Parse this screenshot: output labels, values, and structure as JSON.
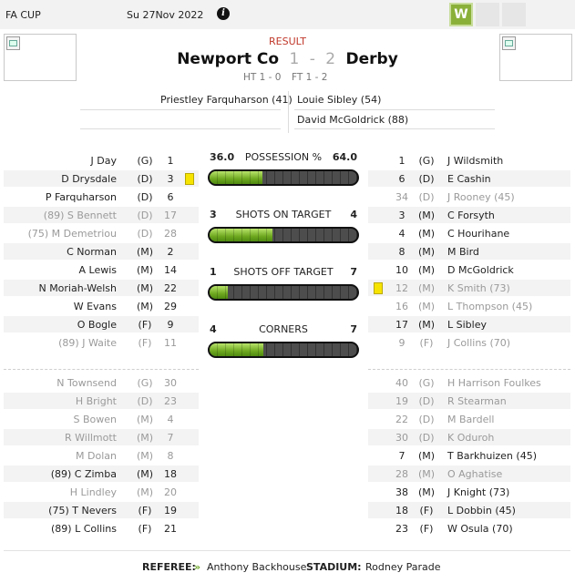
{
  "header": {
    "competition": "FA CUP",
    "date": "Su 27Nov 2022",
    "info_icon": "info-icon",
    "form_badge": "W"
  },
  "match": {
    "result_label": "RESULT",
    "home_team": "Newport Co",
    "away_team": "Derby",
    "home_score": "1",
    "separator": "-",
    "away_score": "2",
    "half_time": "HT 1 - 0",
    "full_time": "FT 1 - 2"
  },
  "scorers": {
    "home": [
      "Priestley Farquharson (41)"
    ],
    "away": [
      "Louie Sibley (54)",
      "David McGoldrick (88)"
    ]
  },
  "home_lineup": [
    {
      "name": "J Day",
      "pos": "(G)",
      "num": "1",
      "dim": false
    },
    {
      "name": "D Drysdale",
      "pos": "(D)",
      "num": "3",
      "dim": false,
      "card": "yellow"
    },
    {
      "name": "P Farquharson",
      "pos": "(D)",
      "num": "6",
      "dim": false
    },
    {
      "name": "(89) S Bennett",
      "pos": "(D)",
      "num": "17",
      "dim": true
    },
    {
      "name": "(75) M Demetriou",
      "pos": "(D)",
      "num": "28",
      "dim": true
    },
    {
      "name": "C Norman",
      "pos": "(M)",
      "num": "2",
      "dim": false
    },
    {
      "name": "A Lewis",
      "pos": "(M)",
      "num": "14",
      "dim": false
    },
    {
      "name": "N Moriah-Welsh",
      "pos": "(M)",
      "num": "22",
      "dim": false
    },
    {
      "name": "W Evans",
      "pos": "(M)",
      "num": "29",
      "dim": false
    },
    {
      "name": "O Bogle",
      "pos": "(F)",
      "num": "9",
      "dim": false
    },
    {
      "name": "(89) J Waite",
      "pos": "(F)",
      "num": "11",
      "dim": true
    }
  ],
  "away_lineup": [
    {
      "num": "1",
      "pos": "(G)",
      "name": "J Wildsmith",
      "dim": false
    },
    {
      "num": "6",
      "pos": "(D)",
      "name": "E Cashin",
      "dim": false
    },
    {
      "num": "34",
      "pos": "(D)",
      "name": "J Rooney (45)",
      "dim": true
    },
    {
      "num": "3",
      "pos": "(M)",
      "name": "C Forsyth",
      "dim": false
    },
    {
      "num": "4",
      "pos": "(M)",
      "name": "C Hourihane",
      "dim": false
    },
    {
      "num": "8",
      "pos": "(M)",
      "name": "M Bird",
      "dim": false
    },
    {
      "num": "10",
      "pos": "(M)",
      "name": "D McGoldrick",
      "dim": false
    },
    {
      "num": "12",
      "pos": "(M)",
      "name": "K Smith (73)",
      "dim": true,
      "card": "yellow"
    },
    {
      "num": "16",
      "pos": "(M)",
      "name": "L Thompson (45)",
      "dim": true
    },
    {
      "num": "17",
      "pos": "(M)",
      "name": "L Sibley",
      "dim": false
    },
    {
      "num": "9",
      "pos": "(F)",
      "name": "J Collins (70)",
      "dim": true
    }
  ],
  "home_subs": [
    {
      "name": "N Townsend",
      "pos": "(G)",
      "num": "30",
      "dim": true
    },
    {
      "name": "H Bright",
      "pos": "(D)",
      "num": "23",
      "dim": true
    },
    {
      "name": "S Bowen",
      "pos": "(M)",
      "num": "4",
      "dim": true
    },
    {
      "name": "R Willmott",
      "pos": "(M)",
      "num": "7",
      "dim": true
    },
    {
      "name": "M Dolan",
      "pos": "(M)",
      "num": "8",
      "dim": true
    },
    {
      "name": "(89) C Zimba",
      "pos": "(M)",
      "num": "18",
      "dim": false
    },
    {
      "name": "H Lindley",
      "pos": "(M)",
      "num": "20",
      "dim": true
    },
    {
      "name": "(75) T Nevers",
      "pos": "(F)",
      "num": "19",
      "dim": false
    },
    {
      "name": "(89) L Collins",
      "pos": "(F)",
      "num": "21",
      "dim": false
    }
  ],
  "away_subs": [
    {
      "num": "40",
      "pos": "(G)",
      "name": "H Harrison Foulkes",
      "dim": true
    },
    {
      "num": "19",
      "pos": "(D)",
      "name": "R Stearman",
      "dim": true
    },
    {
      "num": "22",
      "pos": "(D)",
      "name": "M Bardell",
      "dim": true
    },
    {
      "num": "30",
      "pos": "(D)",
      "name": "K Oduroh",
      "dim": true
    },
    {
      "num": "7",
      "pos": "(M)",
      "name": "T Barkhuizen (45)",
      "dim": false
    },
    {
      "num": "28",
      "pos": "(M)",
      "name": "O Aghatise",
      "dim": true
    },
    {
      "num": "38",
      "pos": "(M)",
      "name": "J Knight (73)",
      "dim": false
    },
    {
      "num": "18",
      "pos": "(F)",
      "name": "L Dobbin (45)",
      "dim": false
    },
    {
      "num": "23",
      "pos": "(F)",
      "name": "W Osula (70)",
      "dim": false
    }
  ],
  "stats": [
    {
      "label": "POSSESSION %",
      "home": "36.0",
      "away": "64.0",
      "home_share": 0.36
    },
    {
      "label": "SHOTS ON TARGET",
      "home": "3",
      "away": "4",
      "home_share": 0.4286
    },
    {
      "label": "SHOTS OFF TARGET",
      "home": "1",
      "away": "7",
      "home_share": 0.125
    },
    {
      "label": "CORNERS",
      "home": "4",
      "away": "7",
      "home_share": 0.3636
    }
  ],
  "footer": {
    "referee_label": "REFEREE:",
    "referee_icon": "chevron-right-icon",
    "referee_icon_glyph": "»",
    "referee": "Anthony Backhouse",
    "stadium_label": "STADIUM:",
    "stadium": "Rodney Parade"
  },
  "colors": {
    "result_label": "#c0392b",
    "bar_fill": "#6ea820",
    "bar_track": "#4d4d4d",
    "yellow_card": "#f6e400",
    "badge_win": "#8bb03a"
  }
}
